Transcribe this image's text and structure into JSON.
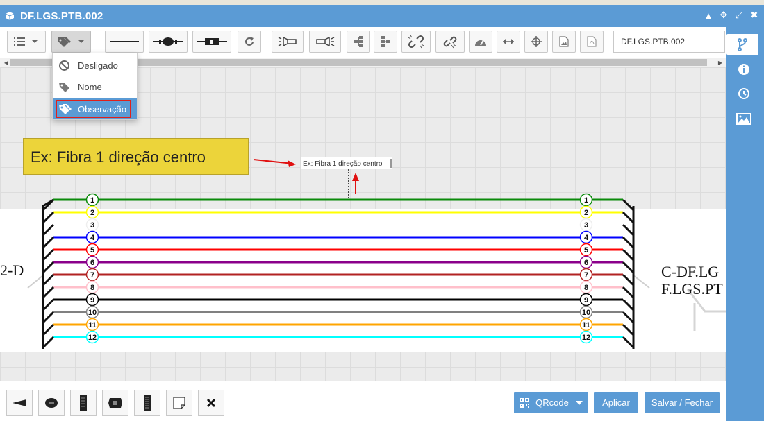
{
  "window": {
    "title": "DF.LGS.PTB.002"
  },
  "toolbar": {
    "name_field_value": "DF.LGS.PTB.002",
    "buttons": [
      "list-icon",
      "tag-icon",
      "line-icon",
      "splice-node-icon",
      "connector-icon",
      "refresh-icon",
      "flashlight-left-icon",
      "flashlight-right-icon",
      "tree-left-icon",
      "tree-right-icon",
      "unlink-icon",
      "link-break-icon",
      "gauge-icon",
      "arrows-horizontal-icon",
      "crosshair-icon",
      "image-icon",
      "pdf-icon"
    ]
  },
  "label_menu": {
    "items": [
      {
        "label": "Desligado",
        "icon": "ban-icon"
      },
      {
        "label": "Nome",
        "icon": "tag-icon"
      },
      {
        "label": "Observação",
        "icon": "tags-icon"
      }
    ],
    "selected_index": 2
  },
  "annotation": {
    "callout_text": "Ex: Fibra 1 direção centro",
    "canvas_label": "Ex: Fibra 1 direção centro"
  },
  "diagram": {
    "left_cable_label": "2-D",
    "right_cable_label_1": "C-DF.LG",
    "right_cable_label_2": "F.LGS.PT",
    "fibers": [
      {
        "number": "1",
        "color": "#0a8a0a"
      },
      {
        "number": "2",
        "color": "#ffff00"
      },
      {
        "number": "3",
        "color": "#ffffff"
      },
      {
        "number": "4",
        "color": "#0000ff"
      },
      {
        "number": "5",
        "color": "#ff0000"
      },
      {
        "number": "6",
        "color": "#8b008b"
      },
      {
        "number": "7",
        "color": "#b22222"
      },
      {
        "number": "8",
        "color": "#ffc0cb"
      },
      {
        "number": "9",
        "color": "#000000"
      },
      {
        "number": "10",
        "color": "#808080"
      },
      {
        "number": "11",
        "color": "#ffa500"
      },
      {
        "number": "12",
        "color": "#00ffff"
      }
    ]
  },
  "sidebar": {
    "items": [
      "branch-icon",
      "info-icon",
      "history-icon",
      "picture-icon"
    ],
    "active_index": 0
  },
  "bottom": {
    "tools": [
      "wedge-icon",
      "round-node-icon",
      "splitter-icon",
      "connector-box-icon",
      "rack-icon",
      "note-icon",
      "close-icon"
    ],
    "qrcode_label": "QRcode",
    "apply_label": "Aplicar",
    "save_close_label": "Salvar / Fechar"
  }
}
